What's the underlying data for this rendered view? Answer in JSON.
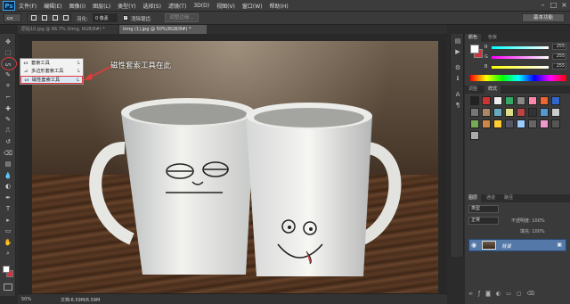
{
  "app": {
    "logo": "Ps",
    "menu": [
      "文件(F)",
      "编辑(E)",
      "图像(I)",
      "图层(L)",
      "类型(Y)",
      "选择(S)",
      "滤镜(T)",
      "3D(D)",
      "视图(V)",
      "窗口(W)",
      "帮助(H)"
    ],
    "window_controls": [
      "–",
      "□",
      "×"
    ]
  },
  "options_bar": {
    "feather_label": "羽化:",
    "feather_value": "0 像素",
    "antialias_label": "消除锯齿",
    "refine_edge_label": "调整边缘...",
    "workspace": "基本功能"
  },
  "tabs": [
    {
      "label": "原始10.jpg @ 66.7% (timg, RGB/8#) *",
      "active": false
    },
    {
      "label": "timg (1).jpg @ 50%(RGB/8#) *",
      "active": true
    }
  ],
  "toolbox": {
    "icons": [
      "move-icon",
      "marquee-icon",
      "lasso-icon",
      "quick-select-icon",
      "crop-icon",
      "eyedropper-icon",
      "healing-icon",
      "brush-icon",
      "clone-stamp-icon",
      "history-brush-icon",
      "eraser-icon",
      "gradient-icon",
      "blur-icon",
      "dodge-icon",
      "pen-icon",
      "type-icon",
      "path-select-icon",
      "shape-icon",
      "hand-icon",
      "zoom-icon"
    ],
    "glyphs": [
      "✥",
      "⬚",
      "ᔕ",
      "✎",
      "⌗",
      "⌐",
      "✚",
      "✎",
      "⎍",
      "↺",
      "⌫",
      "▤",
      "💧",
      "◐",
      "✒",
      "T",
      "▸",
      "▭",
      "✋",
      "⌕"
    ],
    "foreground_color": "#ffffff",
    "background_color": "#d0313a"
  },
  "flyout": {
    "items": [
      {
        "icon": "ᔕ",
        "label": "套索工具",
        "shortcut": "L"
      },
      {
        "icon": "⊿",
        "label": "多边形套索工具",
        "shortcut": "L"
      },
      {
        "icon": "ᔕ",
        "label": "磁性套索工具",
        "shortcut": "L",
        "selected": true
      }
    ]
  },
  "annotation": "磁性套索工具在此",
  "status": {
    "zoom": "50%",
    "doc_info": "文档:6.59M/6.59M"
  },
  "panels": {
    "color_tabs": [
      "颜色",
      "色板"
    ],
    "sliders": [
      {
        "label": "R",
        "value": "255",
        "gradient": "linear-gradient(90deg,#00ffff,#ffffff)"
      },
      {
        "label": "G",
        "value": "255",
        "gradient": "linear-gradient(90deg,#ff00ff,#ffffff)"
      },
      {
        "label": "B",
        "value": "255",
        "gradient": "linear-gradient(90deg,#ffff00,#ffffff)"
      }
    ],
    "style_tabs": [
      "调整",
      "样式"
    ],
    "layer_tabs": [
      "图层",
      "通道",
      "路径"
    ],
    "layer_kind": "类型",
    "blend_mode": "正常",
    "opacity_label": "不透明度: 100%",
    "fill_label": "填充: 100%",
    "layer_name": "背景"
  }
}
